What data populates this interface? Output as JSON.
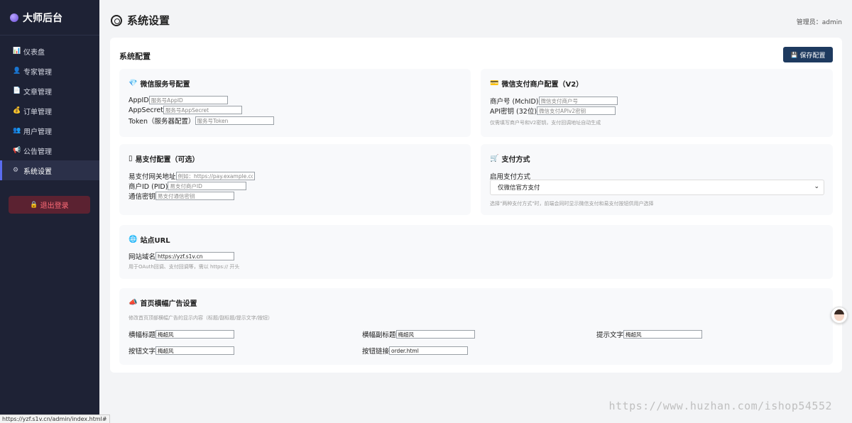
{
  "sidebar": {
    "brand": "大师后台",
    "items": [
      {
        "icon": "📊",
        "label": "仪表盘"
      },
      {
        "icon": "👤",
        "label": "专家管理"
      },
      {
        "icon": "📄",
        "label": "文章管理"
      },
      {
        "icon": "💰",
        "label": "订单管理"
      },
      {
        "icon": "👥",
        "label": "用户管理"
      },
      {
        "icon": "📢",
        "label": "公告管理"
      },
      {
        "icon": "⚙",
        "label": "系统设置"
      }
    ],
    "logout_icon": "🔒",
    "logout_label": "退出登录"
  },
  "status_url": "https://yzf.s1v.cn/admin/index.html#",
  "header": {
    "title": "系统设置",
    "admin": "管理员：admin"
  },
  "card": {
    "title": "系统配置",
    "save_icon": "💾",
    "save_label": "保存配置"
  },
  "wechat": {
    "icon": "💎",
    "title": "微信服务号配置",
    "appid_label": "AppID",
    "appid_placeholder": "服务号AppID",
    "secret_label": "AppSecret",
    "secret_placeholder": "服务号AppSecret",
    "token_label": "Token（服务器配置）",
    "token_placeholder": "服务号Token"
  },
  "merchant": {
    "icon": "💳",
    "title": "微信支付商户配置（V2）",
    "mchid_label": "商户号 (MchID)",
    "mchid_placeholder": "微信支付商户号",
    "key_label": "API密钥 (32位)",
    "key_placeholder": "微信支付APIv2密钥",
    "hint": "仅需填写商户号和V2密钥，支付回调地址自动生成"
  },
  "epay": {
    "icon": "▯",
    "title": "易支付配置（可选）",
    "gateway_label": "易支付网关地址",
    "gateway_placeholder": "例如：https://pay.example.com",
    "pid_label": "商户ID (PID)",
    "pid_placeholder": "易支付商户ID",
    "key_label": "通信密钥",
    "key_placeholder": "易支付通信密钥"
  },
  "paymethod": {
    "icon": "🛒",
    "title": "支付方式",
    "enable_label": "启用支付方式",
    "selected": "仅微信官方支付",
    "hint": "选择\"两种支付方式\"时，前端会同时显示微信支付和易支付按钮供用户选择"
  },
  "site": {
    "icon": "🌐",
    "title": "站点URL",
    "domain_label": "网站域名",
    "domain_value": "https://yzf.s1v.cn",
    "hint": "用于OAuth回调、支付回调等，需以 https:// 开头"
  },
  "banner": {
    "icon": "📣",
    "title": "首页横幅广告设置",
    "desc": "修改首页顶部横幅广告的显示内容（标题/副标题/提示文字/按钮）",
    "title_label": "横幅标题",
    "title_value": "梅超风",
    "subtitle_label": "横幅副标题",
    "subtitle_value": "梅超风",
    "tip_label": "提示文字",
    "tip_value": "梅超风",
    "btn_text_label": "按钮文字",
    "btn_text_value": "梅超风",
    "btn_link_label": "按钮链接",
    "btn_link_value": "order.html"
  },
  "watermark": "https://www.huzhan.com/ishop54552"
}
